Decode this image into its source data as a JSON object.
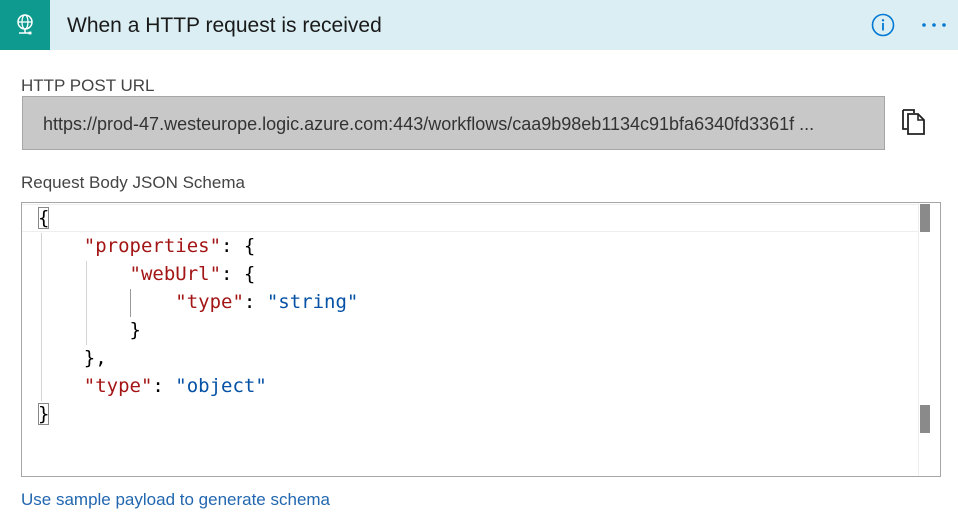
{
  "trigger": {
    "icon": "globe-network-icon",
    "title": "When a HTTP request is received",
    "info_icon": "info-icon",
    "more_icon": "more-ellipsis-icon"
  },
  "url_field": {
    "label": "HTTP POST URL",
    "value": "https://prod-47.westeurope.logic.azure.com:443/workflows/caa9b98eb1134c91bfa6340fd3361f ...",
    "copy_icon": "copy-icon"
  },
  "schema_field": {
    "label": "Request Body JSON Schema",
    "lines": [
      [
        {
          "t": "p",
          "v": "{"
        }
      ],
      [
        {
          "t": "p",
          "v": "    "
        },
        {
          "t": "k",
          "v": "\"properties\""
        },
        {
          "t": "p",
          "v": ": {"
        }
      ],
      [
        {
          "t": "p",
          "v": "        "
        },
        {
          "t": "k",
          "v": "\"webUrl\""
        },
        {
          "t": "p",
          "v": ": {"
        }
      ],
      [
        {
          "t": "p",
          "v": "            "
        },
        {
          "t": "k",
          "v": "\"type\""
        },
        {
          "t": "p",
          "v": ": "
        },
        {
          "t": "s",
          "v": "\"string\""
        }
      ],
      [
        {
          "t": "p",
          "v": "        }"
        }
      ],
      [
        {
          "t": "p",
          "v": "    },"
        }
      ],
      [
        {
          "t": "p",
          "v": "    "
        },
        {
          "t": "k",
          "v": "\"type\""
        },
        {
          "t": "p",
          "v": ": "
        },
        {
          "t": "s",
          "v": "\"object\""
        }
      ],
      [
        {
          "t": "p",
          "v": "}"
        }
      ]
    ]
  },
  "generate_link": "Use sample payload to generate schema",
  "colors": {
    "header_bg": "#daeef3",
    "icon_bg": "#0e9a8f",
    "accent": "#0078d4",
    "json_key": "#a31515",
    "json_string": "#0451a5",
    "link": "#2267b0"
  }
}
